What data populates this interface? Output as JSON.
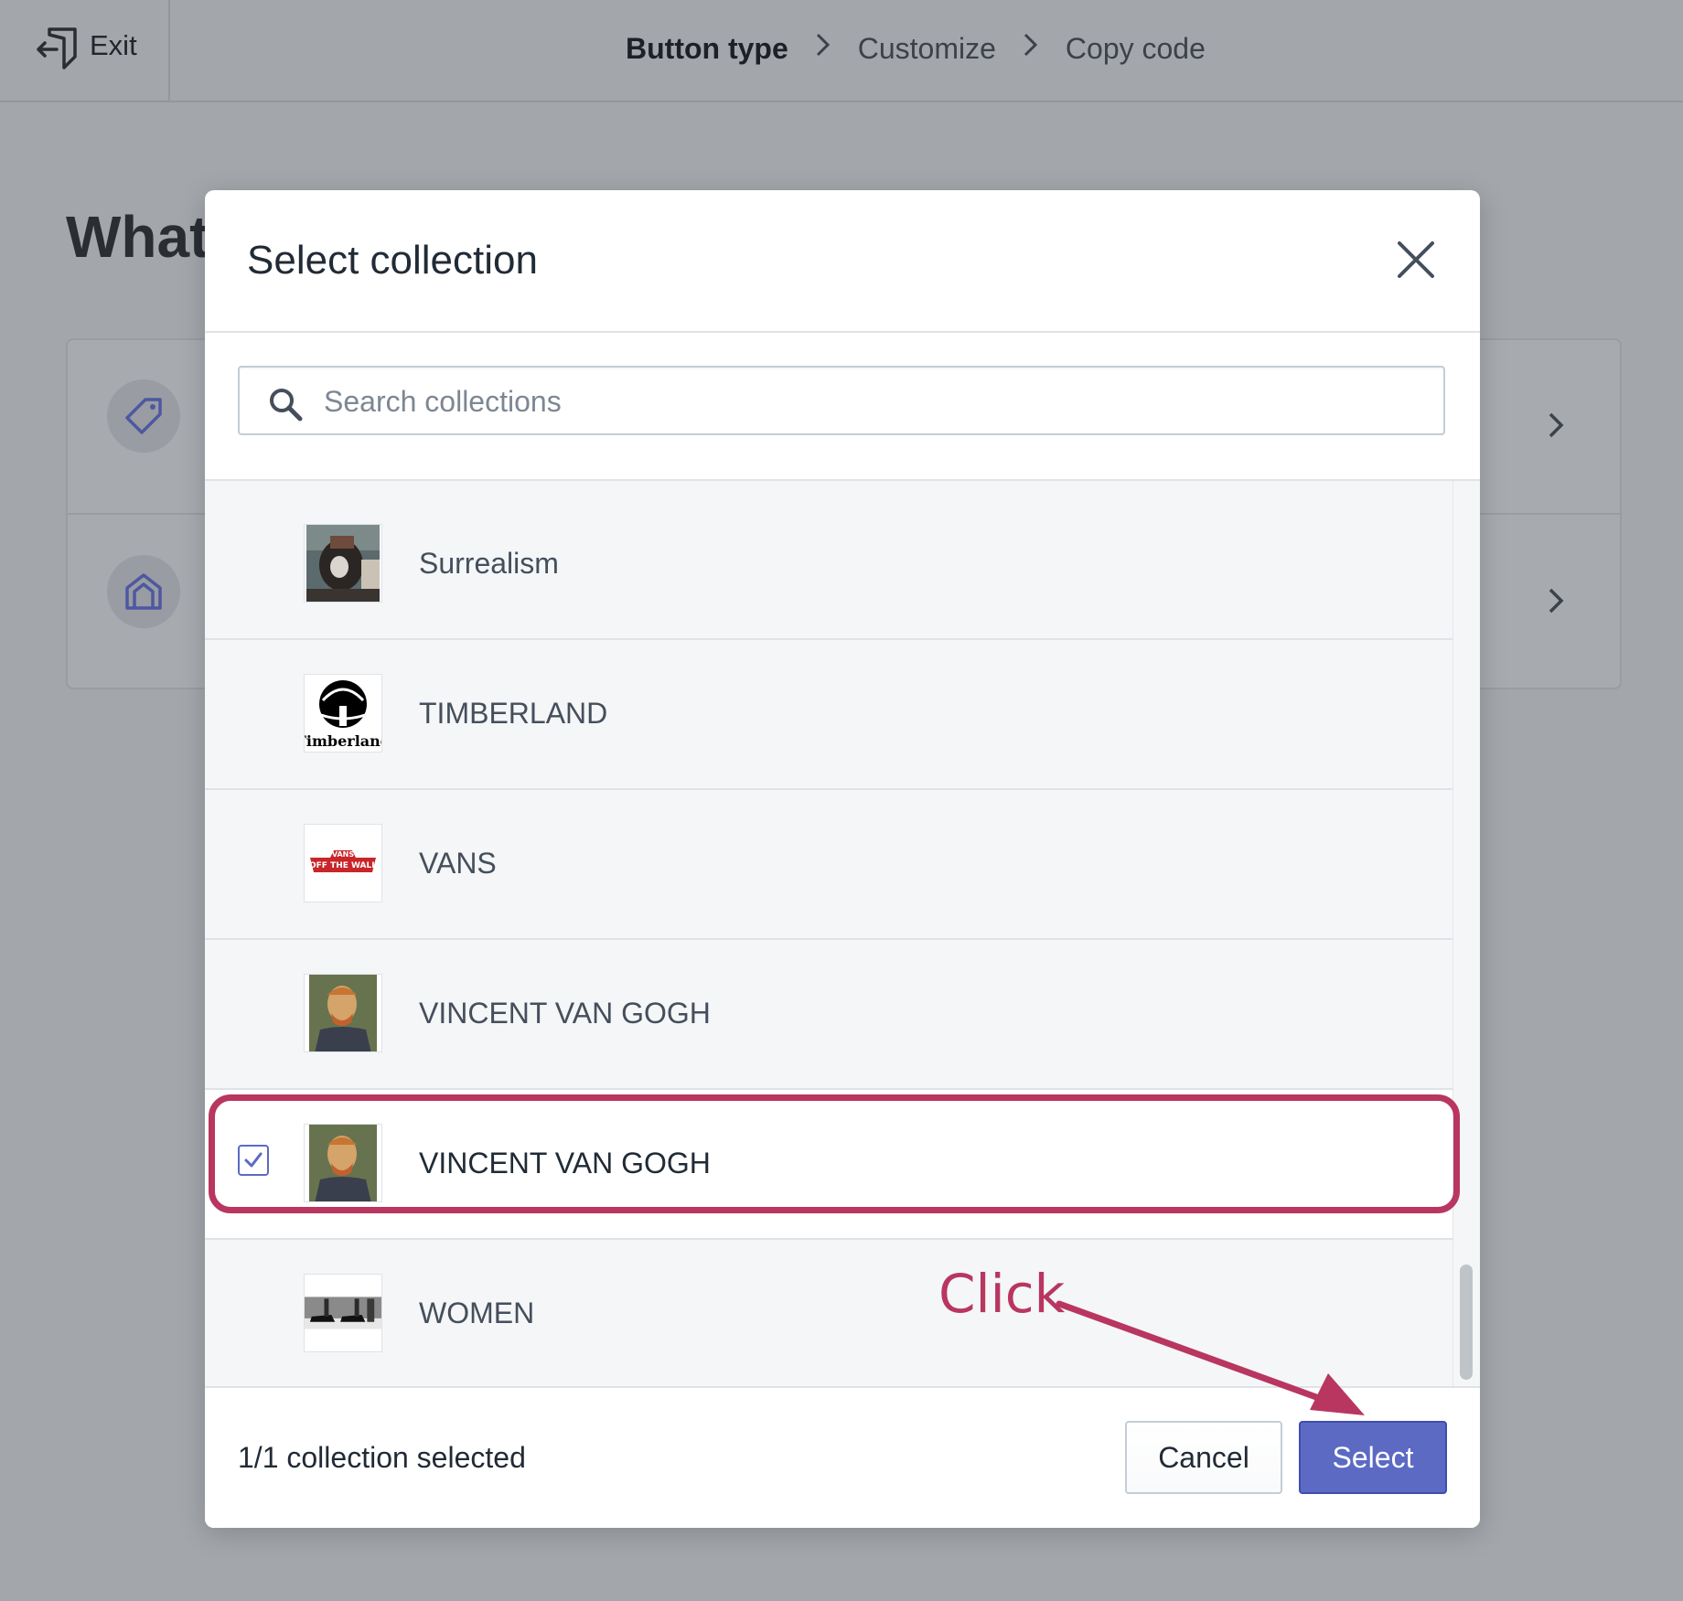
{
  "topbar": {
    "exit_label": "Exit",
    "steps": [
      {
        "label": "Button type",
        "active": true
      },
      {
        "label": "Customize",
        "active": false
      },
      {
        "label": "Copy code",
        "active": false
      }
    ]
  },
  "background": {
    "heading": "What"
  },
  "modal": {
    "title": "Select collection",
    "search": {
      "placeholder": "Search collections",
      "value": ""
    },
    "collections": [
      {
        "label": "Surrealism",
        "thumbnail": "surrealism-painting",
        "selected": false
      },
      {
        "label": "TIMBERLAND",
        "thumbnail": "timberland-logo",
        "selected": false
      },
      {
        "label": "VANS",
        "thumbnail": "vans-logo",
        "selected": false
      },
      {
        "label": "VINCENT VAN GOGH",
        "thumbnail": "van-gogh-portrait",
        "selected": false
      },
      {
        "label": "VINCENT VAN GOGH",
        "thumbnail": "van-gogh-portrait",
        "selected": true
      },
      {
        "label": "WOMEN",
        "thumbnail": "women-sneakers",
        "selected": false
      }
    ],
    "footer": {
      "selected_count": "1/1 collection selected",
      "cancel_label": "Cancel",
      "select_label": "Select"
    }
  },
  "annotation": {
    "click_label": "Click",
    "color": "#b8365f"
  },
  "colors": {
    "primary": "#5c6ac4",
    "overlay": "#a3a6ab"
  },
  "thumbnail_texts": {
    "timberland": "Timberland",
    "vans_top": "VANS",
    "vans_bottom": "OFF THE WALL"
  }
}
